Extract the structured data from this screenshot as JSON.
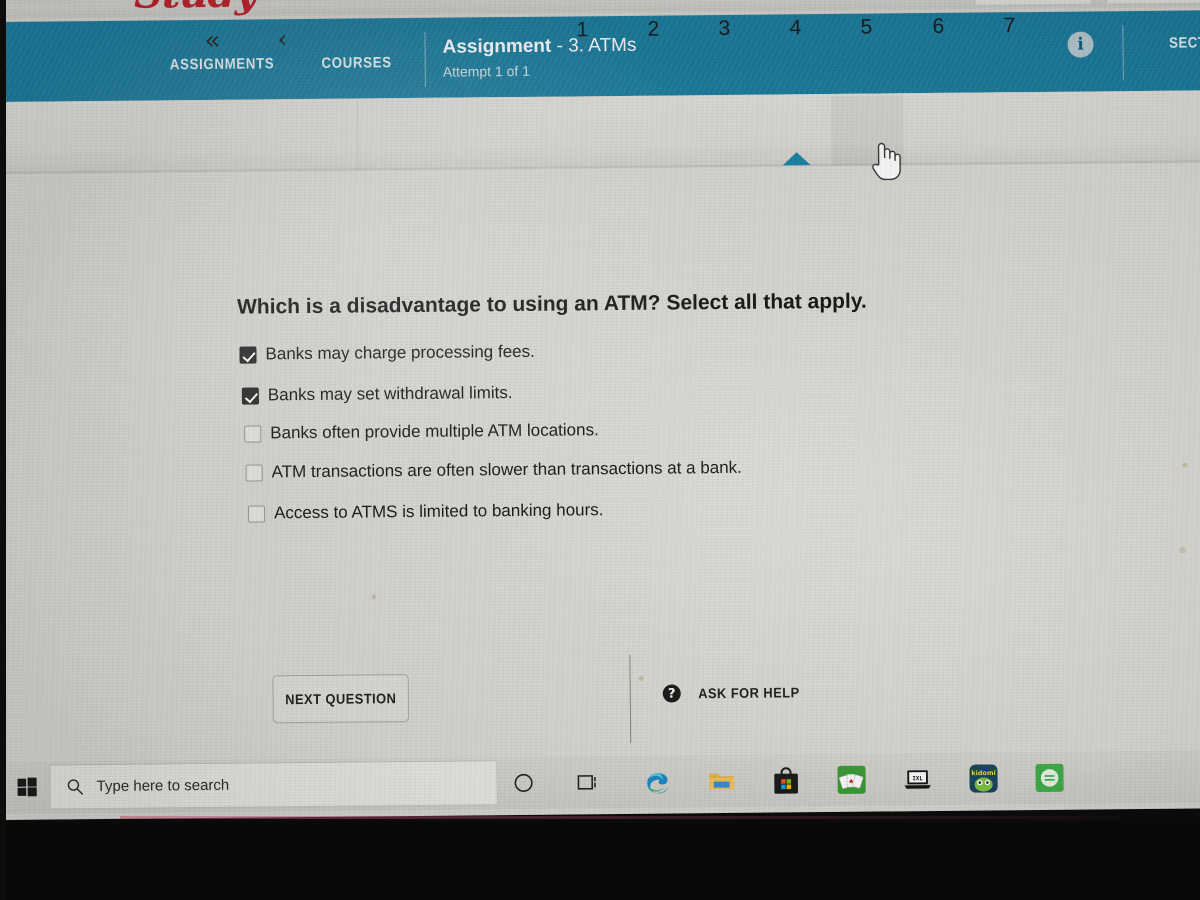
{
  "browser": {
    "logo_text": "Study",
    "tabs": [
      "",
      ""
    ]
  },
  "header": {
    "nav_assignments": "ASSIGNMENTS",
    "nav_courses": "COURSES",
    "title_main": "Assignment",
    "title_suffix": " - 3. ATMs",
    "attempt": "Attempt 1 of 1",
    "info_glyph": "i",
    "section_label": "SECT",
    "background_color": "#1c7fa1"
  },
  "question_nav": {
    "first_glyph": "«",
    "prev_glyph": "‹",
    "numbers": [
      "1",
      "2",
      "3",
      "4",
      "5",
      "6",
      "7"
    ],
    "active_number": "4",
    "hovered_number": "5",
    "active_marker_color": "#1b87a8"
  },
  "question": {
    "prompt": "Which is a disadvantage to using an ATM? Select all that apply.",
    "choices": [
      {
        "label": "Banks may charge processing fees.",
        "checked": true
      },
      {
        "label": "Banks may set withdrawal limits.",
        "checked": true
      },
      {
        "label": "Banks often provide multiple ATM locations.",
        "checked": false
      },
      {
        "label": "ATM transactions are often slower than transactions at a bank.",
        "checked": false
      },
      {
        "label": "Access to ATMS is limited to banking hours.",
        "checked": false
      }
    ]
  },
  "footer": {
    "next_question_label": "NEXT QUESTION",
    "help_glyph": "?",
    "ask_for_help_label": "ASK FOR HELP"
  },
  "taskbar": {
    "start_name": "windows-start",
    "search_placeholder": "Type here to search",
    "cortana_glyph": "○",
    "taskview_glyph": "⧉",
    "apps": [
      {
        "name": "microsoft-edge",
        "label": ""
      },
      {
        "name": "file-explorer",
        "label": ""
      },
      {
        "name": "microsoft-store",
        "label": ""
      },
      {
        "name": "solitaire",
        "label": ""
      },
      {
        "name": "laptop-app",
        "label": "IXL"
      },
      {
        "name": "kidomi",
        "label": "kidomi"
      },
      {
        "name": "green-circle-app",
        "label": ""
      }
    ]
  }
}
